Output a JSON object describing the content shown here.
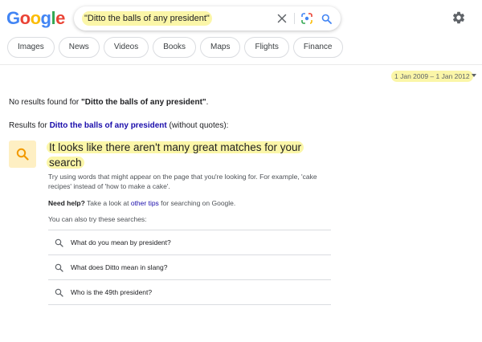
{
  "logo": {
    "letters": [
      "G",
      "o",
      "o",
      "g",
      "l",
      "e"
    ],
    "colors": [
      "#4285F4",
      "#EA4335",
      "#FBBC05",
      "#4285F4",
      "#34A853",
      "#EA4335"
    ]
  },
  "search": {
    "query": "\"Ditto the balls of any president\""
  },
  "icons": {
    "clear": "close-icon",
    "lens": "lens-camera-icon",
    "search": "search-icon",
    "settings": "gear-icon",
    "suggestion": "search-icon"
  },
  "tabs": [
    {
      "label": "Images"
    },
    {
      "label": "News"
    },
    {
      "label": "Videos"
    },
    {
      "label": "Books"
    },
    {
      "label": "Maps"
    },
    {
      "label": "Flights"
    },
    {
      "label": "Finance"
    }
  ],
  "date_filter": {
    "label": "1 Jan 2009 – 1 Jan 2012"
  },
  "no_results": {
    "prefix": "No results found for ",
    "query": "\"Ditto the balls of any president\"",
    "suffix": "."
  },
  "results_for": {
    "prefix": "Results for ",
    "query": "Ditto the balls of any president",
    "suffix": " (without quotes):"
  },
  "suggestion": {
    "headline_line1": "It looks like there aren't many great matches for your",
    "headline_line2": "search",
    "tip": "Try using words that might appear on the page that you're looking for. For example, 'cake recipes' instead of 'how to make a cake'.",
    "help_label": "Need help?",
    "help_text": " Take a look at ",
    "help_link": "other tips",
    "help_suffix": " for searching on Google.",
    "also_try": "You can also try these searches:"
  },
  "related_searches": [
    {
      "text": "What do you mean by president?"
    },
    {
      "text": "What does Ditto mean in slang?"
    },
    {
      "text": "Who is the 49th president?"
    }
  ],
  "colors": {
    "highlight": "#fbf6a8",
    "link": "#1a0dab",
    "suggestion_box": "#feefc3",
    "suggestion_icon": "#f29900"
  }
}
